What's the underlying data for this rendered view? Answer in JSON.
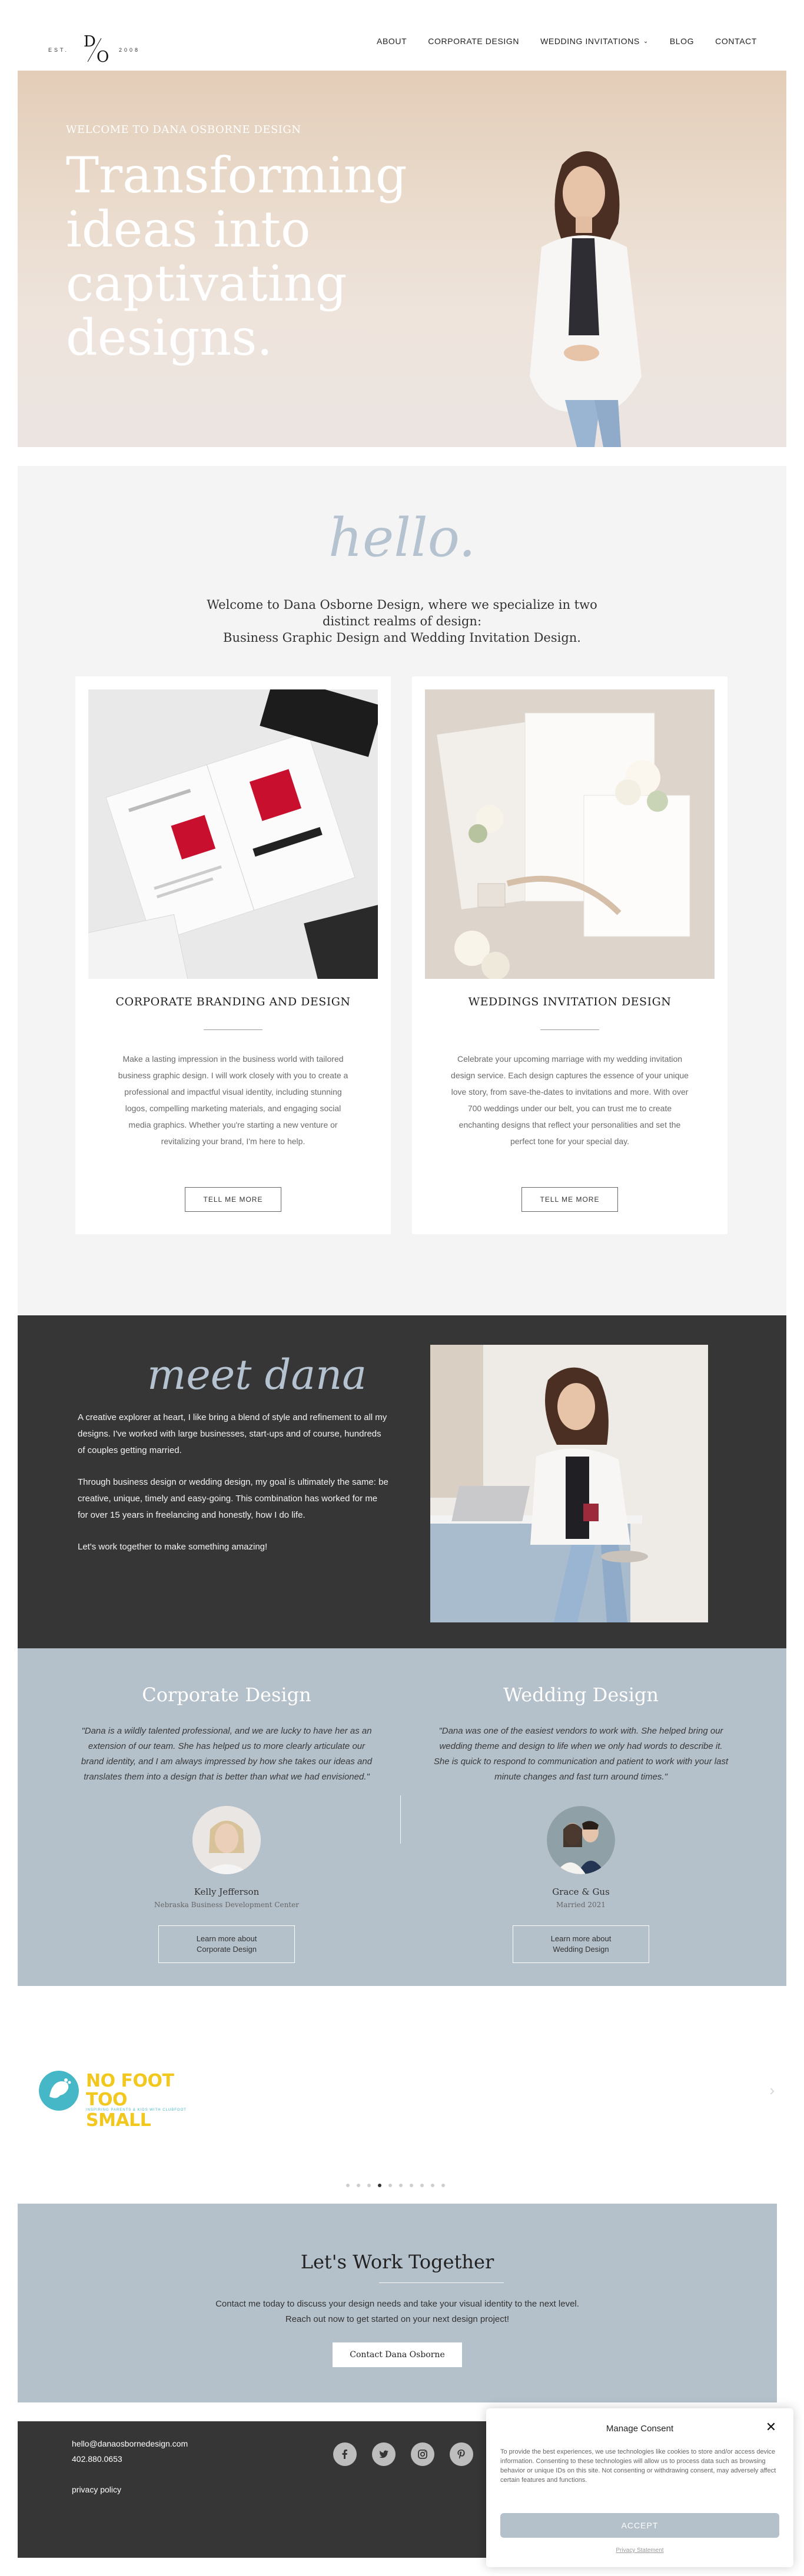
{
  "header": {
    "logo_est": "EST.",
    "logo_d": "D",
    "logo_o": "O",
    "logo_year": "2008",
    "nav": [
      {
        "label": "ABOUT"
      },
      {
        "label": "CORPORATE DESIGN"
      },
      {
        "label": "WEDDING INVITATIONS"
      },
      {
        "label": "BLOG"
      },
      {
        "label": "CONTACT"
      }
    ]
  },
  "hero": {
    "eyebrow": "WELCOME TO DANA OSBORNE DESIGN",
    "headline": "Transforming ideas into captivating designs."
  },
  "intro": {
    "hello": "hello.",
    "lead_1": "Welcome to Dana Osborne Design, where we specialize in two distinct realms of design:",
    "lead_2": "Business Graphic Design and Wedding Invitation Design."
  },
  "services": [
    {
      "title": "CORPORATE BRANDING AND DESIGN",
      "desc": "Make a lasting impression in the business world with tailored business graphic design. I will work closely with you to create a professional and impactful visual identity, including stunning logos, compelling marketing materials, and engaging social media graphics. Whether you're starting a new venture or revitalizing your brand, I'm here to help.",
      "button": "TELL ME MORE"
    },
    {
      "title": "WEDDINGS INVITATION DESIGN",
      "desc": "Celebrate your upcoming marriage with my wedding invitation design service. Each design captures the essence of your unique love story, from save-the-dates to invitations and more. With over 700 weddings under our belt, you can trust me to create enchanting designs that reflect your personalities and set the perfect tone for your special day.",
      "button": "TELL ME MORE"
    }
  ],
  "meet": {
    "heading": "meet dana",
    "paragraphs": [
      "A creative explorer at heart, I like bring a blend of style and refinement to all my designs. I've worked with large businesses, start-ups and of course, hundreds of couples getting married.",
      "Through business design or wedding design, my goal is ultimately the same: be creative, unique, timely and easy-going. This combination has worked for me for over 15 years in freelancing and honestly, how I do life.",
      "Let's work together to make something amazing!"
    ]
  },
  "testimonials": [
    {
      "heading": "Corporate Design",
      "quote": "\"Dana is a wildly talented professional, and we are lucky to have her as an extension of our team. She has helped us to more clearly articulate our brand identity, and I am always impressed by how she takes our ideas and translates them into a design that is better than what we had envisioned.\"",
      "name": "Kelly Jefferson",
      "role": "Nebraska Business Development Center",
      "button_1": "Learn more about",
      "button_2": "Corporate Design"
    },
    {
      "heading": "Wedding Design",
      "quote": "\"Dana was one of the easiest vendors to work with. She helped bring our wedding theme and design to life when we only had words to describe it. She is quick to respond to communication and patient to work with your last minute changes and fast turn around times.\"",
      "name": "Grace & Gus",
      "role": "Married 2021",
      "button_1": "Learn more about",
      "button_2": "Wedding Design"
    }
  ],
  "logos": {
    "client_line1": "NO FOOT",
    "client_line2": "TOO SMALL",
    "client_tag": "INSPIRING PARENTS & KIDS WITH CLUBFOOT",
    "next_arrow": "›",
    "dots_total": 10,
    "dots_active_index": 3
  },
  "cta": {
    "heading": "Let's Work Together",
    "text_1": "Contact me today to discuss your design needs and take your visual identity to the next level.",
    "text_2": "Reach out now to get started on your next design project!",
    "button": "Contact Dana Osborne"
  },
  "footer": {
    "email": "hello@danaosbornedesign.com",
    "phone": "402.880.0653",
    "privacy": "privacy policy",
    "socials": [
      "facebook-icon",
      "twitter-icon",
      "instagram-icon",
      "pinterest-icon"
    ]
  },
  "consent": {
    "title": "Manage Consent",
    "text": "To provide the best experiences, we use technologies like cookies to store and/or access device information. Consenting to these technologies will allow us to process data such as browsing behavior or unique IDs on this site. Not consenting or withdrawing consent, may adversely affect certain features and functions.",
    "accept": "ACCEPT",
    "statement": "Privacy Statement"
  },
  "colors": {
    "accent": "#b4c0ca",
    "dark": "#363636",
    "client_yellow": "#f2c81f",
    "client_teal": "#45b7c6"
  }
}
